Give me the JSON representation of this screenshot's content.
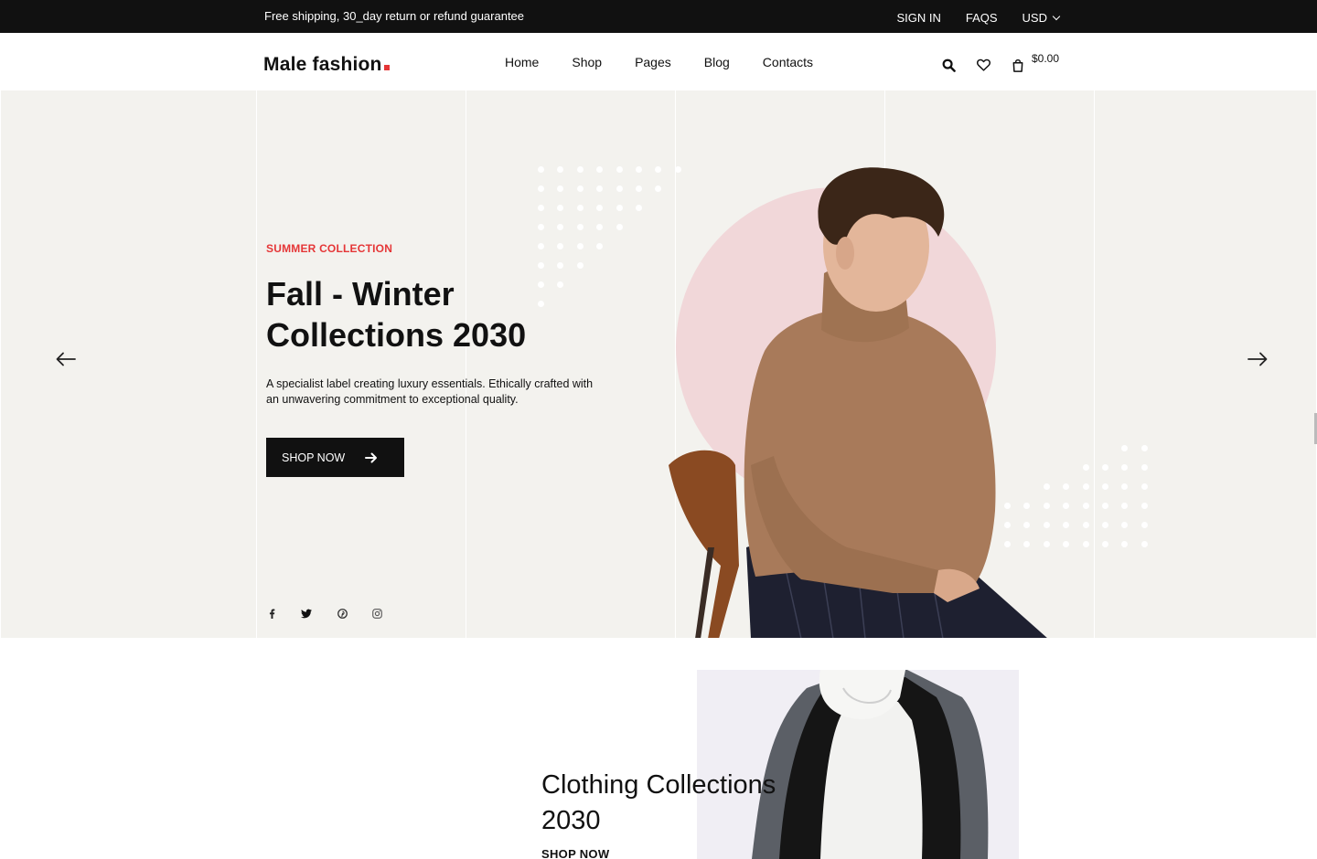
{
  "topbar": {
    "promo": "Free shipping, 30_day return or refund guarantee",
    "sign_in": "SIGN IN",
    "faqs": "FAQS",
    "currency": "USD"
  },
  "header": {
    "logo": "Male fashion",
    "nav": [
      "Home",
      "Shop",
      "Pages",
      "Blog",
      "Contacts"
    ],
    "cart_total": "$0.00",
    "icons": [
      "search-icon",
      "heart-icon",
      "bag-icon"
    ]
  },
  "hero": {
    "eyebrow": "SUMMER COLLECTION",
    "title": "Fall - Winter Collections 2030",
    "description": "A specialist label creating luxury essentials. Ethically crafted with an unwavering commitment to exceptional quality.",
    "button": "SHOP NOW",
    "social_icons": [
      "facebook-icon",
      "twitter-icon",
      "pinterest-icon",
      "instagram-icon"
    ],
    "colors": {
      "accent": "#e53637",
      "background": "#f3f2ee",
      "circle": "#f1d7d9"
    }
  },
  "banner": {
    "title": "Clothing Collections 2030",
    "link": "SHOP NOW"
  }
}
